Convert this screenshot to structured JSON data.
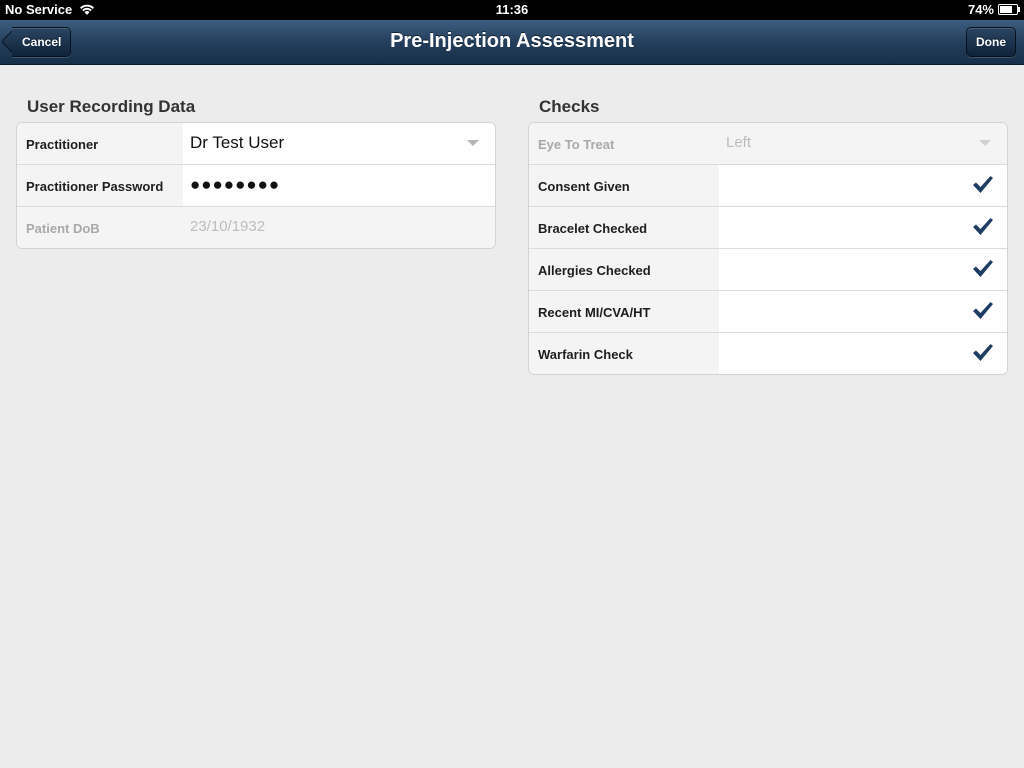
{
  "status_bar": {
    "carrier": "No Service",
    "time": "11:36",
    "battery": "74%",
    "battery_level": 0.74
  },
  "nav": {
    "title": "Pre-Injection Assessment",
    "cancel_label": "Cancel",
    "done_label": "Done"
  },
  "user_recording": {
    "title": "User Recording Data",
    "rows": [
      {
        "label": "Practitioner",
        "value": "Dr Test User"
      },
      {
        "label": "Practitioner Password",
        "value": "●●●●●●●●"
      },
      {
        "label": "Patient DoB",
        "value": "23/10/1932"
      }
    ]
  },
  "checks": {
    "title": "Checks",
    "eye": {
      "label": "Eye To Treat",
      "value": "Left"
    },
    "items": [
      {
        "label": "Consent Given",
        "checked": true
      },
      {
        "label": "Bracelet Checked",
        "checked": true
      },
      {
        "label": "Allergies Checked",
        "checked": true
      },
      {
        "label": "Recent MI/CVA/HT",
        "checked": true
      },
      {
        "label": "Warfarin Check",
        "checked": true
      }
    ]
  },
  "colors": {
    "nav_bar": "#243f5c",
    "checkmark": "#1f3d63",
    "background": "#ececec"
  }
}
